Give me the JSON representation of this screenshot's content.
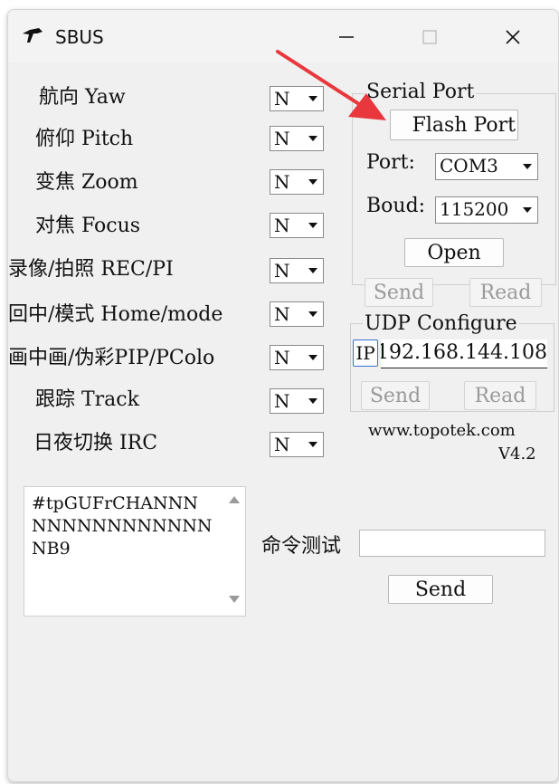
{
  "window": {
    "title": "SBUS",
    "icon": "drone-icon"
  },
  "titlebar": {
    "minimize": "—",
    "maximize": "☐",
    "close": "✕"
  },
  "rows": [
    {
      "label": "航向 Yaw",
      "value": "N"
    },
    {
      "label": "俯仰 Pitch",
      "value": "N"
    },
    {
      "label": "变焦 Zoom",
      "value": "N"
    },
    {
      "label": "对焦 Focus",
      "value": "N"
    },
    {
      "label": "录像/拍照 REC/PI",
      "value": "N"
    },
    {
      "label": "回中/模式 Home/mode",
      "value": "N"
    },
    {
      "label": "画中画/伪彩PIP/PColo",
      "value": "N"
    },
    {
      "label": "跟踪 Track",
      "value": "N"
    },
    {
      "label": "日夜切换 IRC",
      "value": "N"
    }
  ],
  "serial": {
    "title": "Serial Port",
    "flash_label": "Flash Port",
    "port_label": "Port:",
    "port_value": "COM3",
    "boud_label": "Boud:",
    "boud_value": "115200",
    "open_label": "Open",
    "send_label": "Send",
    "read_label": "Read"
  },
  "udp": {
    "title": "UDP Configure",
    "ip_label": "IP",
    "ip_value": "192.168.144.108",
    "send_label": "Send",
    "read_label": "Read"
  },
  "footer": {
    "website": "www.topotek.com",
    "version": "V4.2"
  },
  "log": {
    "text": "#tpGUFrCHANNNNNNNNNNNNNNNNB9"
  },
  "command": {
    "label": "命令测试",
    "value": "",
    "send_label": "Send"
  },
  "colors": {
    "arrow": "#e8383d",
    "window_bg": "#f0f0f0"
  }
}
